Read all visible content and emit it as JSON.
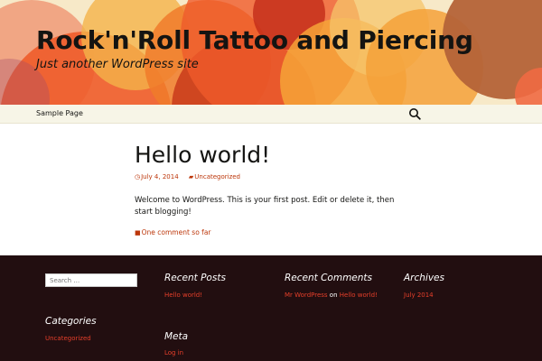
{
  "header": {
    "site_title": "Rock'n'Roll Tattoo and Piercing",
    "tagline": "Just another WordPress site",
    "colors": {
      "background": "#f7e9c8",
      "circle_orange": "#e8521f",
      "circle_light": "#f2a93b",
      "circle_brown": "#b5683a"
    }
  },
  "nav": {
    "sample_page": "Sample Page",
    "search_icon": "search-icon"
  },
  "post": {
    "title": "Hello world!",
    "date": "July 4, 2014",
    "category": "Uncategorized",
    "body": "Welcome to WordPress. This is your first post. Edit or delete it, then start blogging!",
    "comments": "One comment so far",
    "accent_color": "#bc360a"
  },
  "footer": {
    "search_placeholder": "Search …",
    "recent_posts": {
      "title": "Recent Posts",
      "items": [
        "Hello world!"
      ]
    },
    "recent_comments": {
      "title": "Recent Comments",
      "author": "Mr WordPress",
      "on": "on",
      "post": "Hello world!"
    },
    "archives": {
      "title": "Archives",
      "items": [
        "July 2014"
      ]
    },
    "categories": {
      "title": "Categories",
      "items": [
        "Uncategorized"
      ]
    },
    "meta": {
      "title": "Meta",
      "items": [
        "Log in"
      ]
    },
    "colors": {
      "background": "#220e10",
      "link": "#e63f2a"
    }
  }
}
